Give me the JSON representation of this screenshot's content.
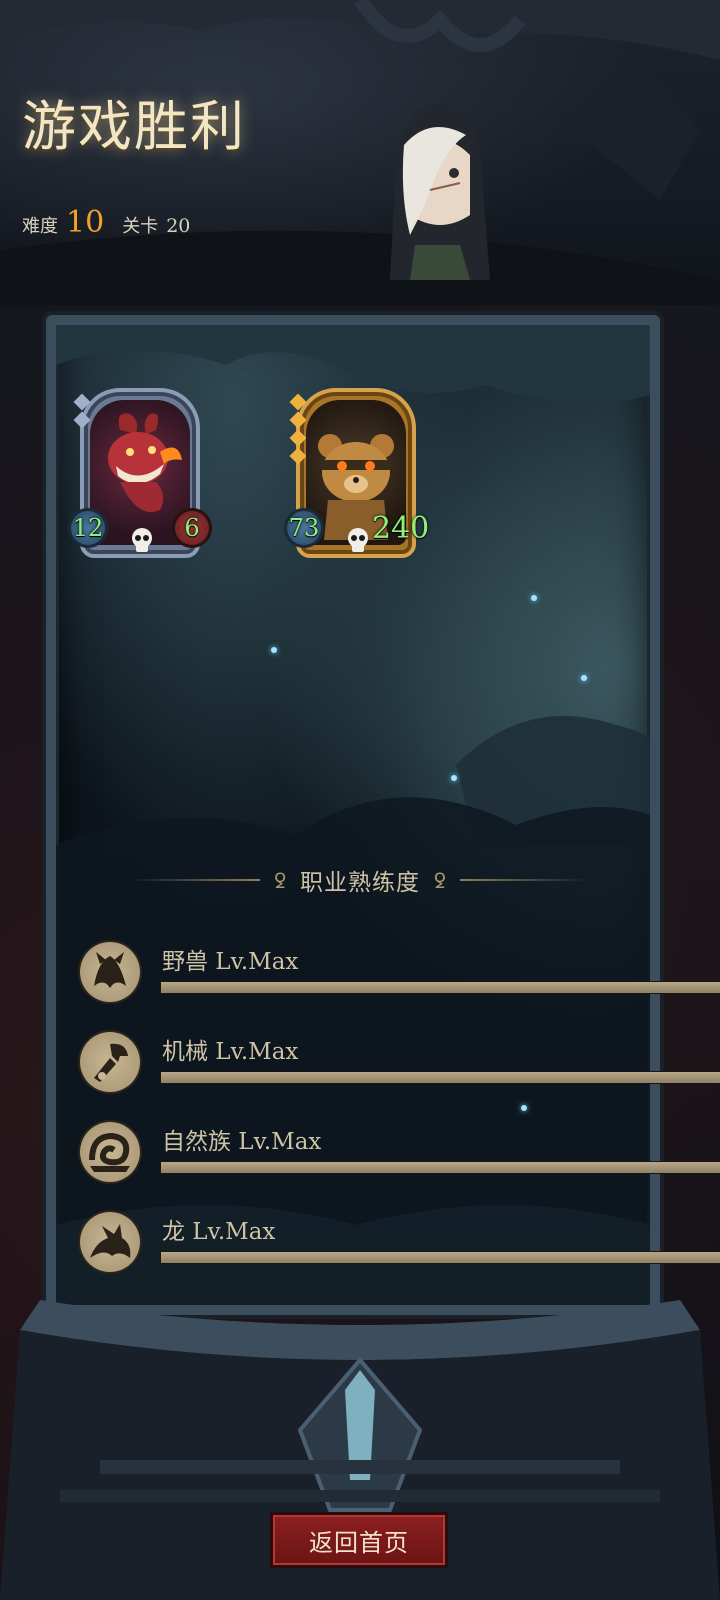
{
  "header": {
    "title": "游戏胜利",
    "difficulty_label": "难度",
    "difficulty_value": "10",
    "stage_label": "关卡",
    "stage_value": "20"
  },
  "cards": [
    {
      "name": "dragon-card",
      "rarity": "silver",
      "attack": "12",
      "health": "6"
    },
    {
      "name": "bear-card",
      "rarity": "gold",
      "attack": "73",
      "health": "240"
    }
  ],
  "proficiency": {
    "title": "职业熟练度",
    "items": [
      {
        "label": "野兽 Lv.Max",
        "icon": "beast-icon",
        "progress": 1.0
      },
      {
        "label": "机械 Lv.Max",
        "icon": "mech-icon",
        "progress": 1.0
      },
      {
        "label": "自然族 Lv.Max",
        "icon": "nature-icon",
        "progress": 1.0
      },
      {
        "label": "龙 Lv.Max",
        "icon": "dragon-icon",
        "progress": 1.0
      }
    ]
  },
  "footer": {
    "home_button": "返回首页"
  },
  "colors": {
    "accent_orange": "#f0a12a",
    "stat_green": "#8ef07a",
    "button_red": "#8d1f20"
  }
}
